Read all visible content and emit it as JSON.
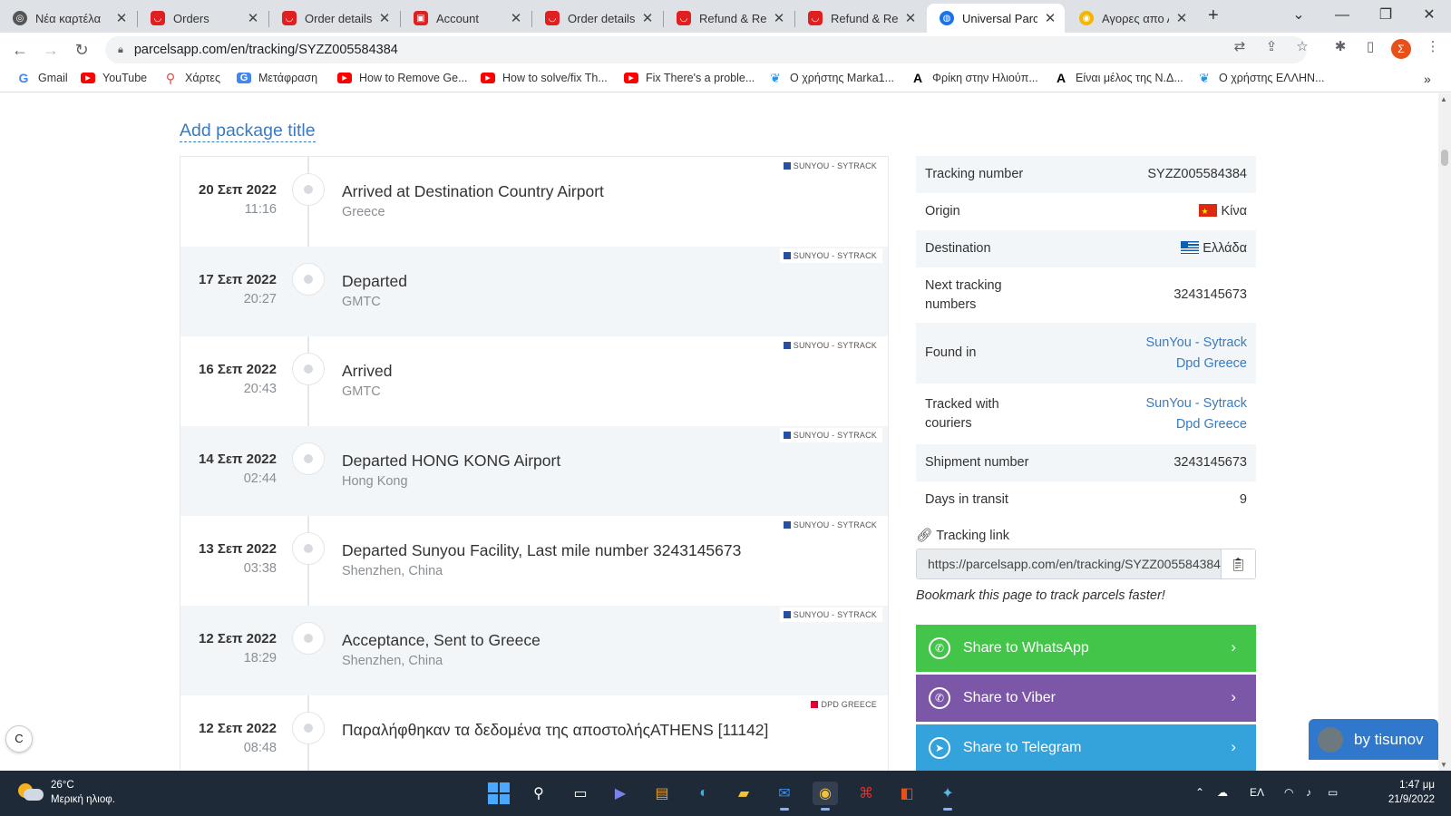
{
  "browser": {
    "tabs": [
      {
        "label": "Νέα καρτέλα",
        "icon": "chrome-icon"
      },
      {
        "label": "Orders",
        "icon": "aliexpress-icon"
      },
      {
        "label": "Order details",
        "icon": "aliexpress-icon"
      },
      {
        "label": "Account",
        "icon": "aliexpress-icon"
      },
      {
        "label": "Order details",
        "icon": "aliexpress-icon"
      },
      {
        "label": "Refund & Retu",
        "icon": "aliexpress-icon"
      },
      {
        "label": "Refund & Retu",
        "icon": "aliexpress-icon"
      },
      {
        "label": "Universal Parc",
        "icon": "globe-icon",
        "active": true
      },
      {
        "label": "Αγορες απο Α",
        "icon": "coin-icon"
      }
    ],
    "url": "parcelsapp.com/en/tracking/SYZZ005584384",
    "bookmarks": [
      {
        "label": "Gmail",
        "icon": "google-icon"
      },
      {
        "label": "YouTube",
        "icon": "youtube-icon"
      },
      {
        "label": "Χάρτες",
        "icon": "maps-icon"
      },
      {
        "label": "Μετάφραση",
        "icon": "translate-icon"
      },
      {
        "label": "How to Remove Ge...",
        "icon": "youtube-icon"
      },
      {
        "label": "How to solve/fix Th...",
        "icon": "youtube-icon"
      },
      {
        "label": "Fix There's a proble...",
        "icon": "youtube-icon"
      },
      {
        "label": "Ο χρήστης Marka1...",
        "icon": "twitter-icon"
      },
      {
        "label": "Φρίκη στην Ηλιούπ...",
        "icon": "a-icon"
      },
      {
        "label": "Είναι μέλος της Ν.Δ...",
        "icon": "a-icon"
      },
      {
        "label": "Ο χρήστης ΕΛΛΗΝ...",
        "icon": "twitter-icon"
      }
    ],
    "profile_initial": "Σ"
  },
  "page": {
    "package_title_link": "Add package title",
    "events": [
      {
        "date": "20 Σεπ 2022",
        "time": "11:16",
        "title": "Arrived at Destination Country Airport",
        "location": "Greece",
        "courier": "SUNYOU - SYTRACK"
      },
      {
        "date": "17 Σεπ 2022",
        "time": "20:27",
        "title": "Departed",
        "location": "GMTC",
        "courier": "SUNYOU - SYTRACK"
      },
      {
        "date": "16 Σεπ 2022",
        "time": "20:43",
        "title": "Arrived",
        "location": "GMTC",
        "courier": "SUNYOU - SYTRACK"
      },
      {
        "date": "14 Σεπ 2022",
        "time": "02:44",
        "title": "Departed HONG KONG Airport",
        "location": "Hong Kong",
        "courier": "SUNYOU - SYTRACK"
      },
      {
        "date": "13 Σεπ 2022",
        "time": "03:38",
        "title": "Departed Sunyou Facility, Last mile number 3243145673",
        "location": "Shenzhen, China",
        "courier": "SUNYOU - SYTRACK"
      },
      {
        "date": "12 Σεπ 2022",
        "time": "18:29",
        "title": "Acceptance, Sent to Greece",
        "location": "Shenzhen, China",
        "courier": "SUNYOU - SYTRACK"
      },
      {
        "date": "12 Σεπ 2022",
        "time": "08:48",
        "title": "Παραλήφθηκαν τα δεδομένα της αποστολήςATHENS [11142]",
        "location": "",
        "courier": "DPD GREECE"
      }
    ],
    "info": {
      "tracking_number_label": "Tracking number",
      "tracking_number": "SYZZ005584384",
      "origin_label": "Origin",
      "origin": "Κίνα",
      "destination_label": "Destination",
      "destination": "Ελλάδα",
      "next_tracking_label_1": "Next tracking",
      "next_tracking_label_2": "numbers",
      "next_tracking": "3243145673",
      "found_in_label": "Found in",
      "found_in": [
        "SunYou - Sytrack",
        "Dpd Greece"
      ],
      "tracked_with_label_1": "Tracked with",
      "tracked_with_label_2": "couriers",
      "tracked_with": [
        "SunYou - Sytrack",
        "Dpd Greece"
      ],
      "shipment_number_label": "Shipment number",
      "shipment_number": "3243145673",
      "days_in_transit_label": "Days in transit",
      "days_in_transit": "9"
    },
    "tracking_link_label": "Tracking link",
    "tracking_link_value": "https://parcelsapp.com/en/tracking/SYZZ005584384",
    "bookmark_hint": "Bookmark this page to track parcels faster!",
    "share": {
      "whatsapp": "Share to WhatsApp",
      "viber": "Share to Viber",
      "telegram": "Share to Telegram"
    },
    "tisunov_label": "by tisunov",
    "c_badge": "C"
  },
  "taskbar": {
    "temperature": "26°C",
    "weather_desc": "Μερική ηλιοφ.",
    "language": "ΕΛ",
    "time": "1:47 μμ",
    "date": "21/9/2022"
  },
  "colors": {
    "link": "#3a7bbf",
    "whatsapp": "#43c54a",
    "viber": "#7d57a7",
    "telegram": "#34a3dc",
    "tisunov": "#2f78cc",
    "taskbar": "#1f2a38"
  }
}
